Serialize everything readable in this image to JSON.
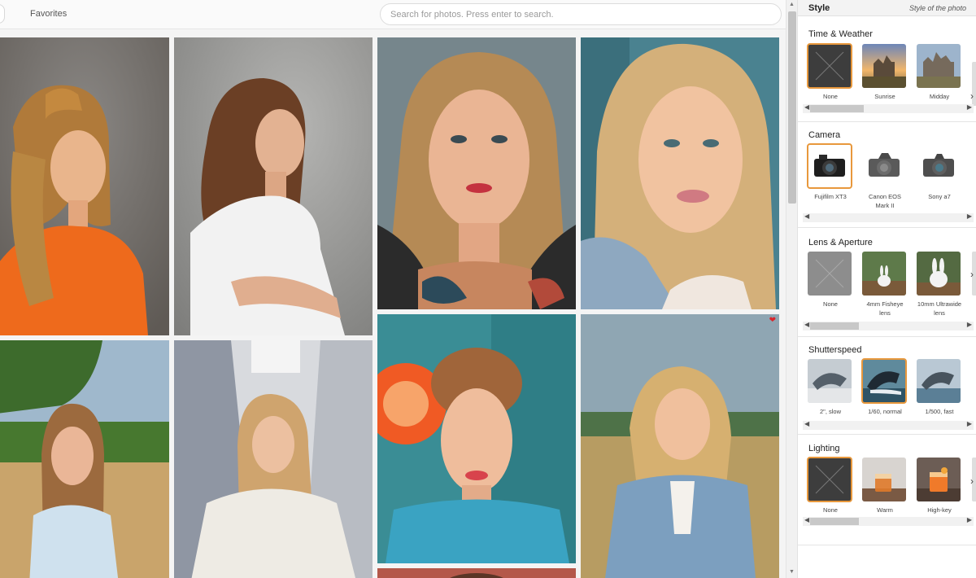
{
  "header": {
    "favorites_label": "Favorites",
    "search_placeholder": "Search for photos. Press enter to search."
  },
  "panel": {
    "title": "Style",
    "subtitle": "Style of the photo",
    "sections": [
      {
        "title": "Time & Weather",
        "options": [
          "None",
          "Sunrise",
          "Midday"
        ],
        "selected": 0
      },
      {
        "title": "Camera",
        "options": [
          "Fujifilm XT3",
          "Canon EOS Mark II",
          "Sony a7"
        ],
        "selected": 0
      },
      {
        "title": "Lens & Aperture",
        "options": [
          "None",
          "4mm Fisheye lens",
          "10mm Ultrawide lens"
        ],
        "selected": -1
      },
      {
        "title": "Shutterspeed",
        "options": [
          "2\", slow",
          "1/60, normal",
          "1/500, fast"
        ],
        "selected": 1
      },
      {
        "title": "Lighting",
        "options": [
          "None",
          "Warm",
          "High-key"
        ],
        "selected": 0
      }
    ]
  },
  "icons": {
    "heart": "heart-icon",
    "next": "chevron-right-icon",
    "left": "chevron-left-icon",
    "right": "chevron-right-icon"
  },
  "colors": {
    "selection_outline": "#e8983c",
    "favorite_heart": "#d9262c"
  }
}
